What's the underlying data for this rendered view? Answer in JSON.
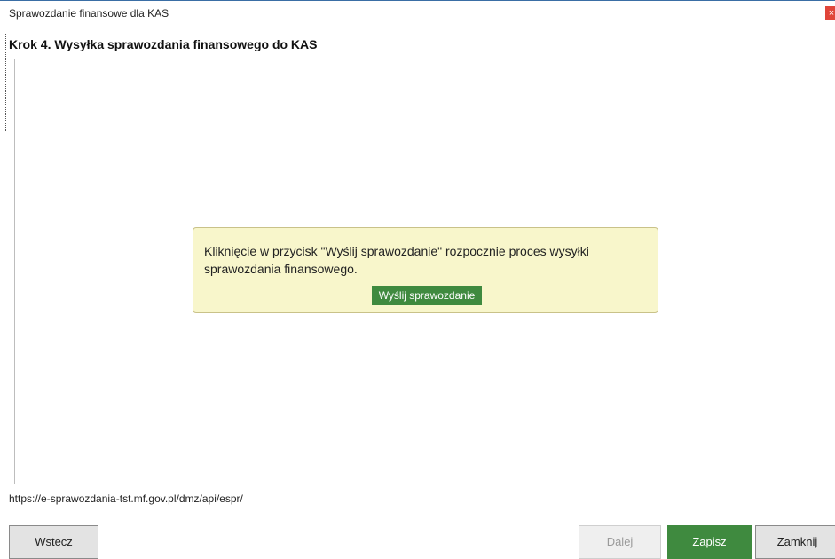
{
  "window": {
    "title": "Sprawozdanie finansowe dla KAS",
    "close_glyph": "×"
  },
  "step": {
    "heading": "Krok 4. Wysyłka sprawozdania finansowego do KAS"
  },
  "info": {
    "message": "Kliknięcie w przycisk \"Wyślij sprawozdanie\" rozpocznie proces wysyłki sprawozdania finansowego.",
    "send_label": "Wyślij sprawozdanie"
  },
  "status": {
    "url": "https://e-sprawozdania-tst.mf.gov.pl/dmz/api/espr/"
  },
  "footer": {
    "back_label": "Wstecz",
    "next_label": "Dalej",
    "save_label": "Zapisz",
    "close_label": "Zamknij"
  },
  "colors": {
    "accent_green": "#3f8a3f",
    "info_background": "#f8f6cb",
    "close_red": "#e0453a"
  },
  "icons": {
    "close": "close-icon"
  }
}
